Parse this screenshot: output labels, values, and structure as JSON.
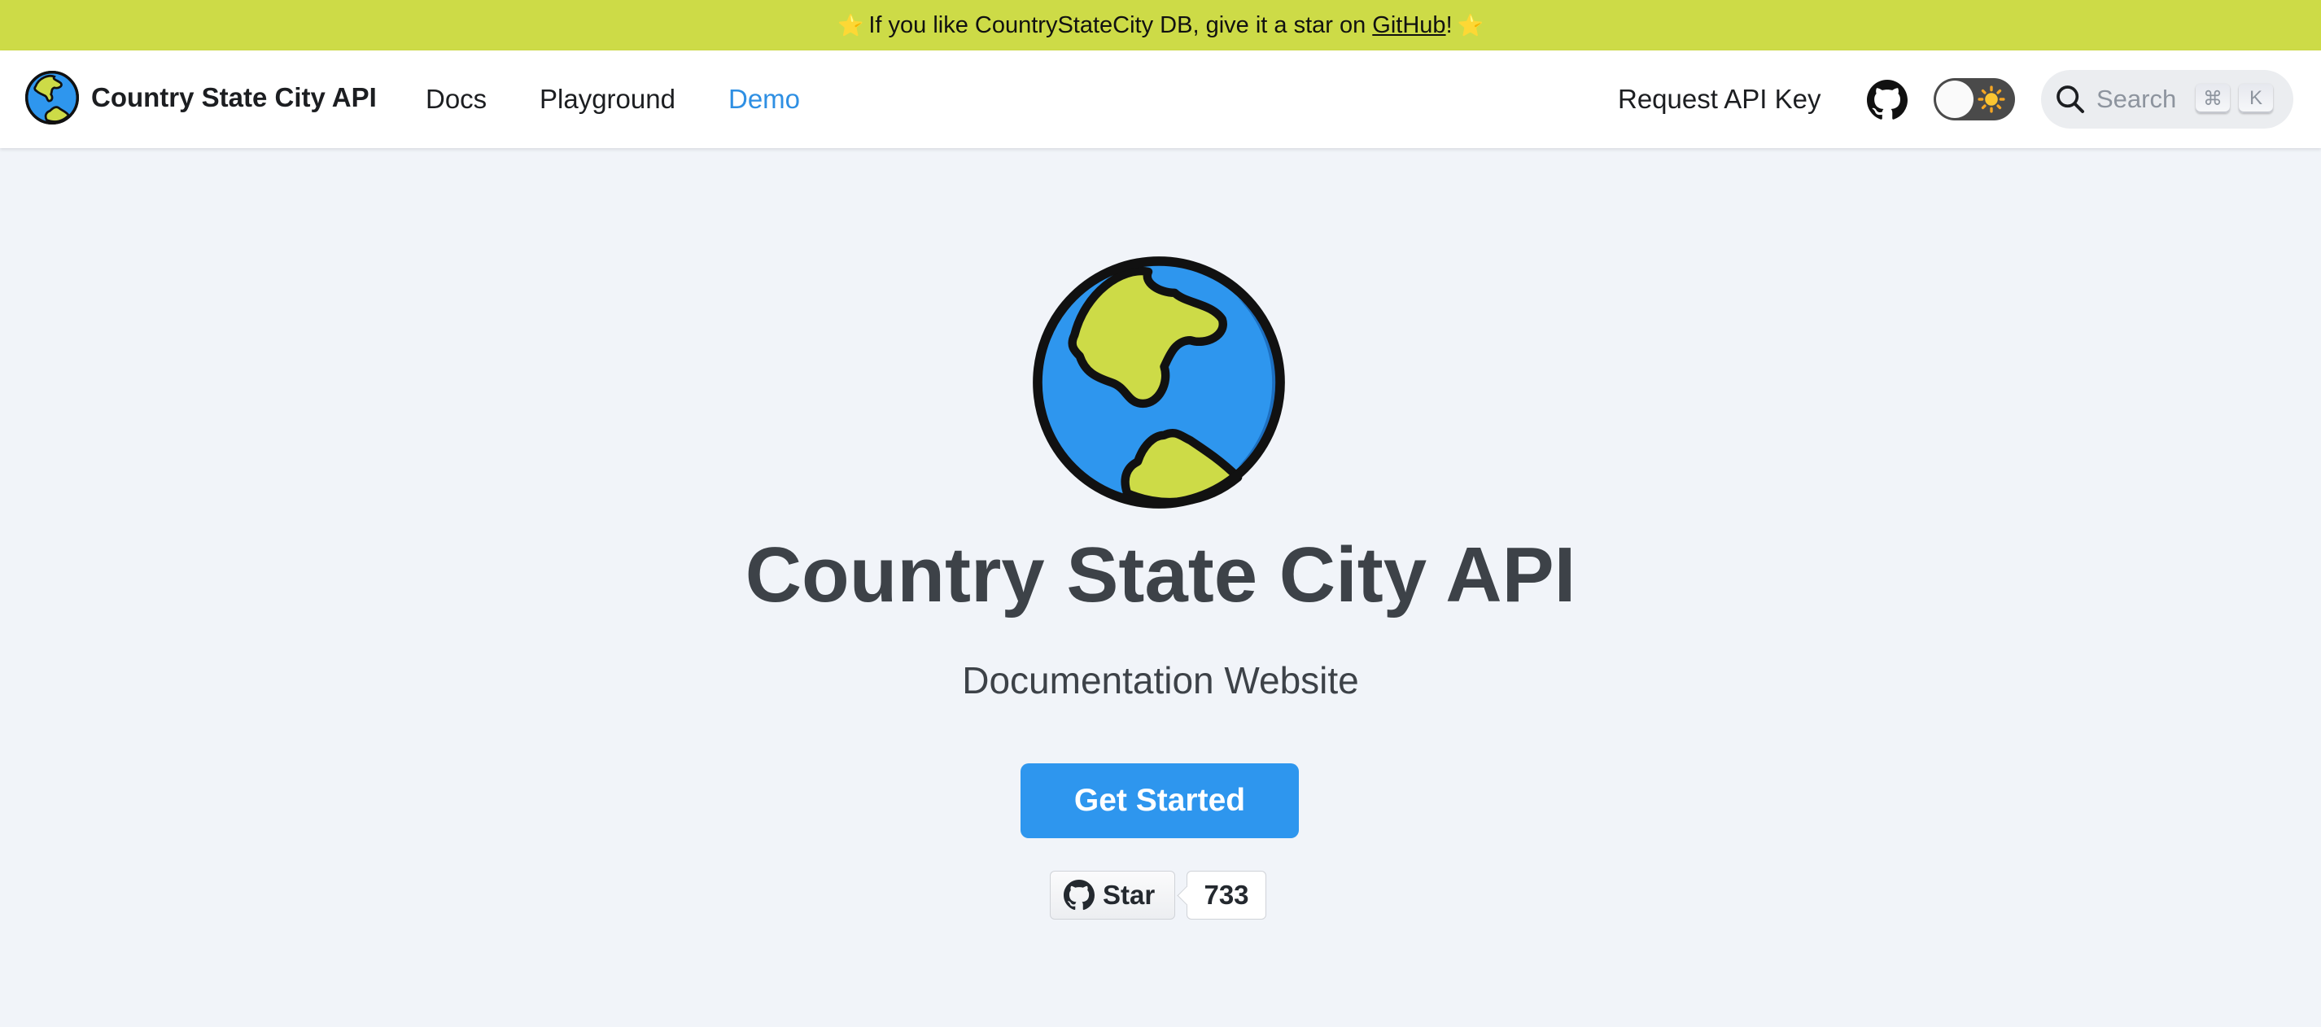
{
  "announcement": {
    "prefix": "If you like CountryStateCity DB, give it a star on ",
    "link_text": "GitHub",
    "suffix": "!",
    "icon": "star-emoji",
    "background_color": "#cddb47"
  },
  "navbar": {
    "brand_title": "Country State City API",
    "brand_icon": "globe-icon",
    "links": [
      {
        "label": "Docs",
        "active": false
      },
      {
        "label": "Playground",
        "active": false
      },
      {
        "label": "Demo",
        "active": true
      }
    ],
    "request_api_key": "Request API Key",
    "github_icon": "github-icon",
    "theme_toggle_icon": "sun-icon",
    "search": {
      "placeholder": "Search",
      "shortcut_keys": [
        "⌘",
        "K"
      ]
    },
    "active_color": "#2e8fe3"
  },
  "hero": {
    "logo_icon": "globe-icon",
    "title": "Country State City API",
    "subtitle": "Documentation Website",
    "cta_label": "Get Started",
    "cta_color": "#2e96ee"
  },
  "github_star": {
    "label": "Star",
    "count": "733"
  }
}
